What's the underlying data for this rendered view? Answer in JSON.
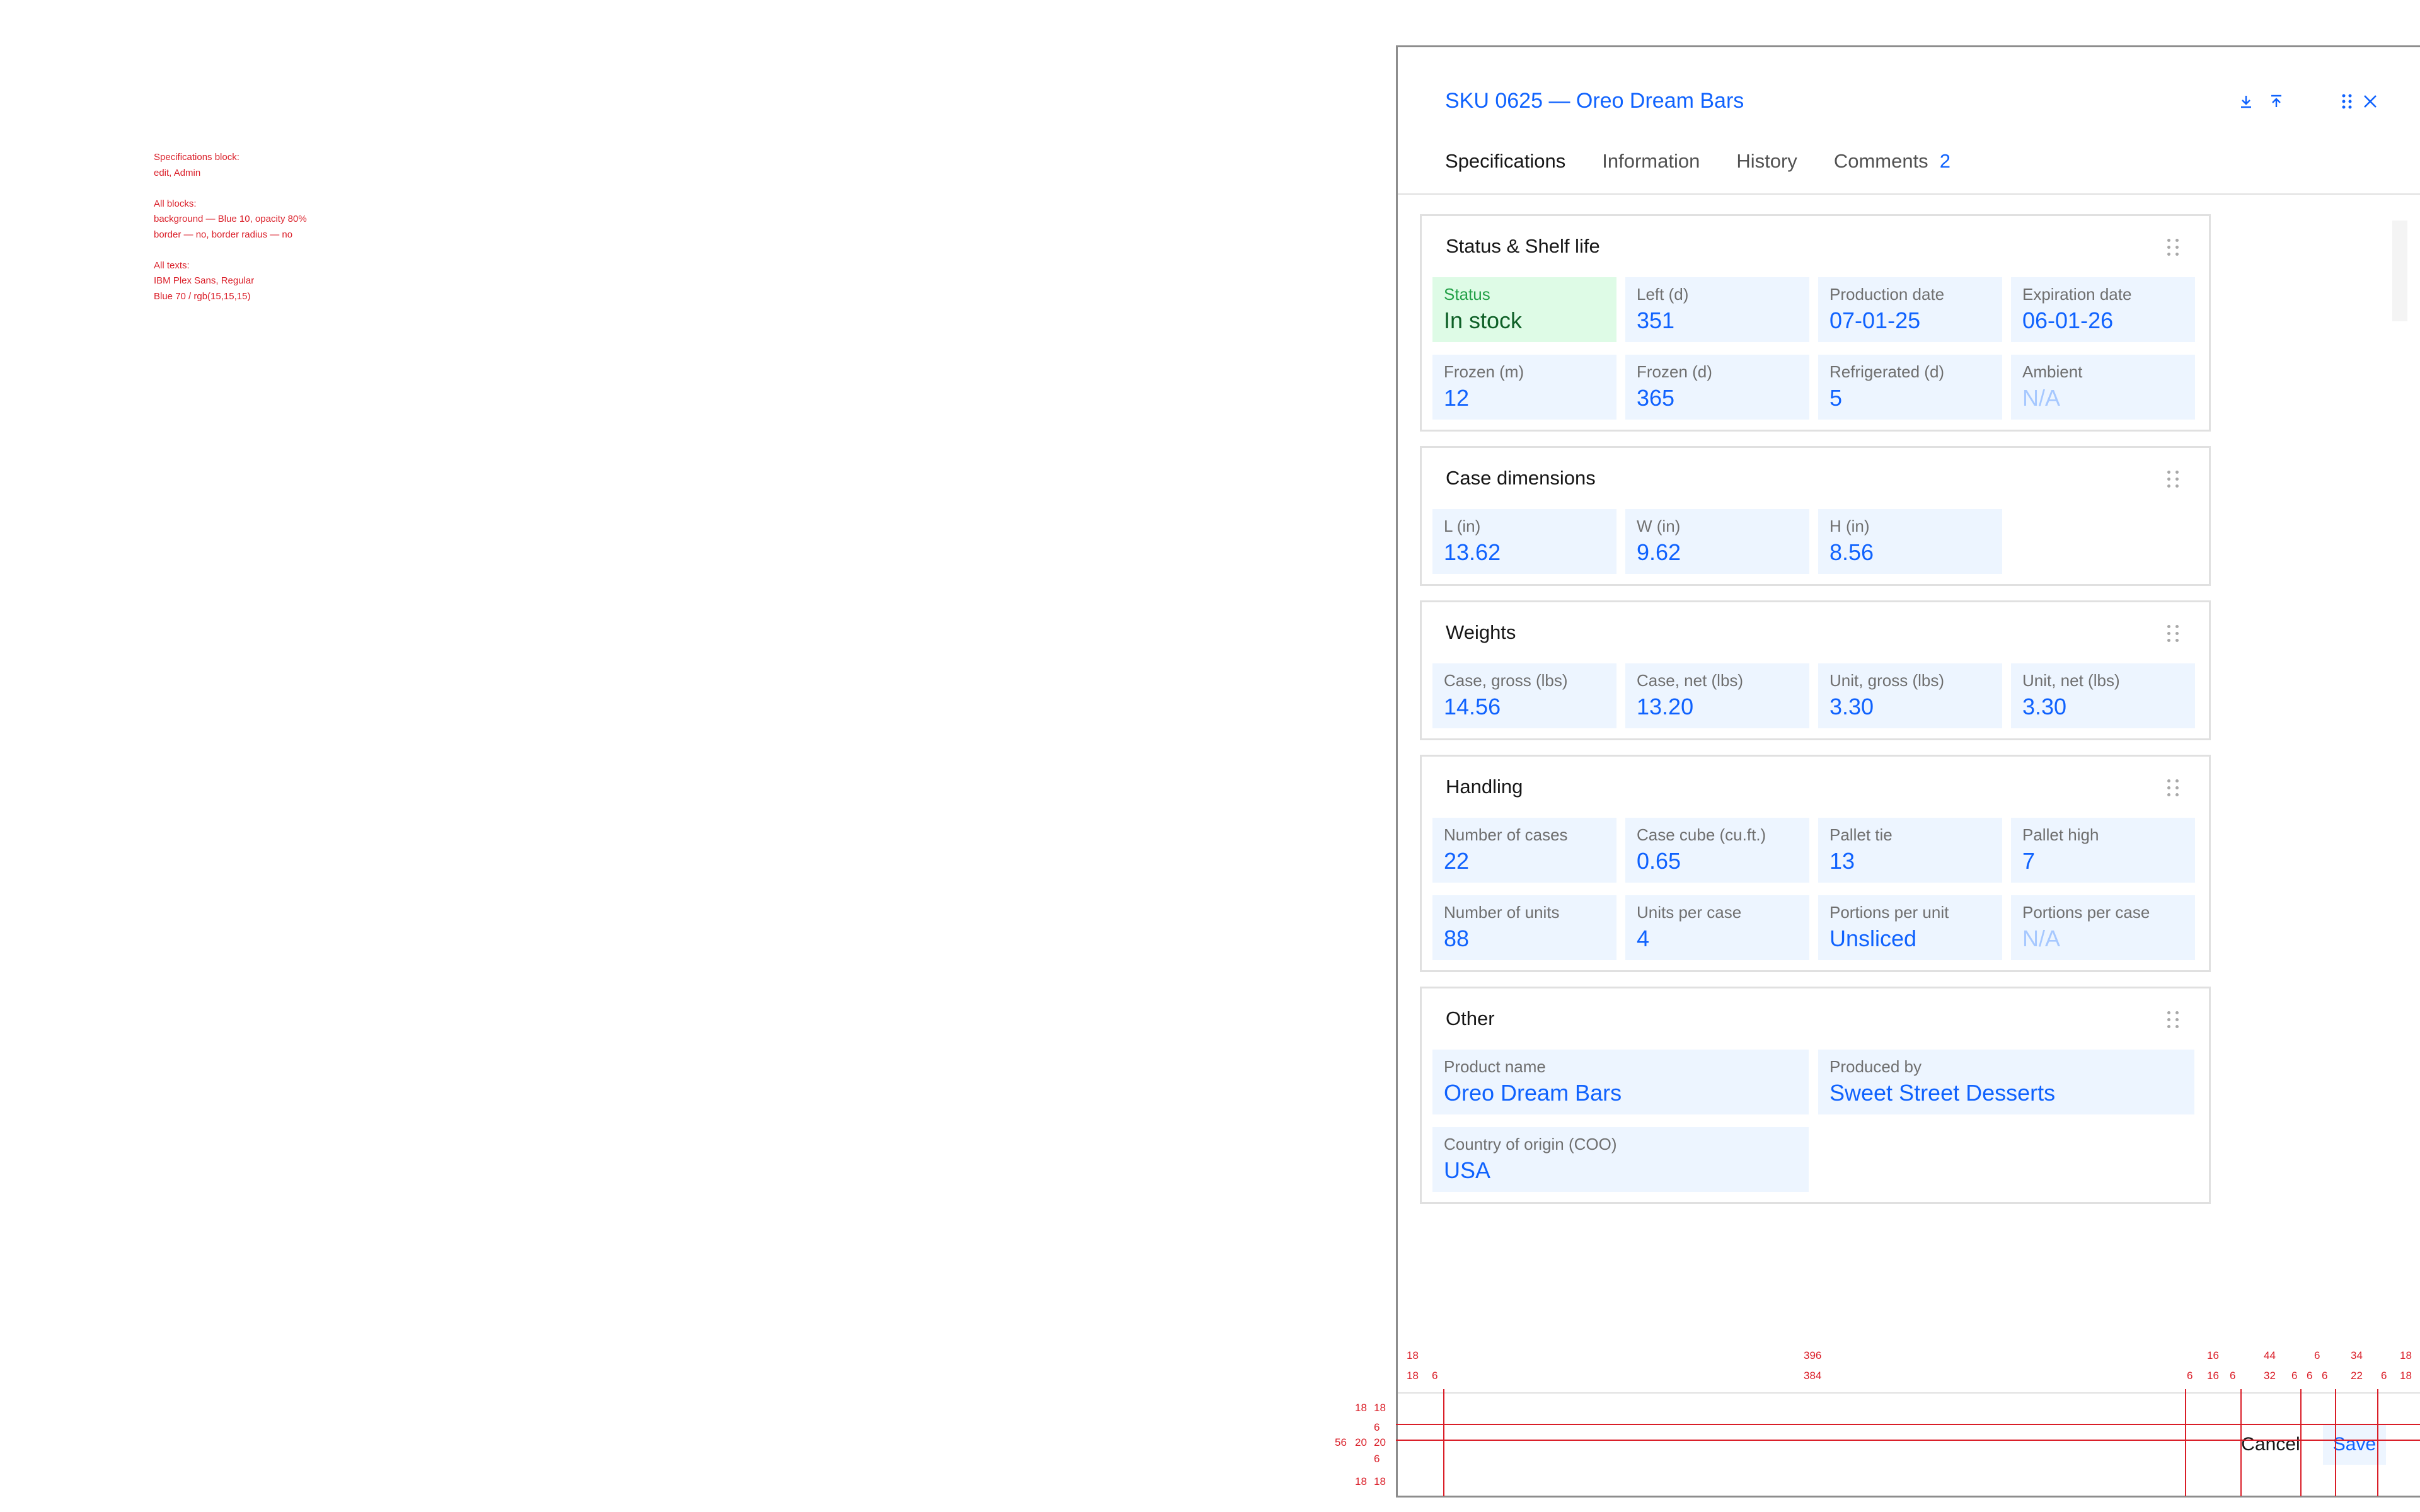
{
  "notes": [
    "Specifications block:\nedit, Admin",
    "All blocks:\nbackground — Blue 10, opacity 80%\nborder — no, border radius — no",
    "All texts:\nIBM Plex Sans, Regular\nBlue 70 / rgb(15,15,15)"
  ],
  "header": {
    "title": "SKU 0625 — Oreo Dream Bars",
    "icons": [
      "download-icon",
      "upload-icon",
      "drag-handle-icon",
      "close-icon"
    ]
  },
  "tabs": [
    {
      "label": "Specifications",
      "active": true
    },
    {
      "label": "Information"
    },
    {
      "label": "History"
    },
    {
      "label": "Comments",
      "count": "2"
    }
  ],
  "blocks": [
    {
      "title": "Status & Shelf life",
      "rows": [
        [
          {
            "label": "Status",
            "value": "In stock",
            "style": "green"
          },
          {
            "label": "Left (d)",
            "value": "351"
          },
          {
            "label": "Production date",
            "value": "07-01-25"
          },
          {
            "label": "Expiration date",
            "value": "06-01-26"
          }
        ],
        [
          {
            "label": "Frozen (m)",
            "value": "12"
          },
          {
            "label": "Frozen (d)",
            "value": "365"
          },
          {
            "label": "Refrigerated (d)",
            "value": "5"
          },
          {
            "label": "Ambient",
            "value": "N/A",
            "na": true
          }
        ]
      ]
    },
    {
      "title": "Case dimensions",
      "rows": [
        [
          {
            "label": "L (in)",
            "value": "13.62"
          },
          {
            "label": "W (in)",
            "value": "9.62"
          },
          {
            "label": "H (in)",
            "value": "8.56"
          }
        ]
      ]
    },
    {
      "title": "Weights",
      "rows": [
        [
          {
            "label": "Case, gross (lbs)",
            "value": "14.56"
          },
          {
            "label": "Case, net (lbs)",
            "value": "13.20"
          },
          {
            "label": "Unit, gross (lbs)",
            "value": "3.30"
          },
          {
            "label": "Unit, net (lbs)",
            "value": "3.30"
          }
        ]
      ]
    },
    {
      "title": "Handling",
      "rows": [
        [
          {
            "label": "Number of cases",
            "value": "22"
          },
          {
            "label": "Case cube (cu.ft.)",
            "value": "0.65"
          },
          {
            "label": "Pallet tie",
            "value": "13"
          },
          {
            "label": "Pallet high",
            "value": "7"
          }
        ],
        [
          {
            "label": "Number of units",
            "value": "88"
          },
          {
            "label": "Units per case",
            "value": "4"
          },
          {
            "label": "Portions per unit",
            "value": "Unsliced"
          },
          {
            "label": "Portions per case",
            "value": "N/A",
            "na": true
          }
        ]
      ]
    },
    {
      "title": "Other",
      "rows": [
        [
          {
            "label": "Product name",
            "value": "Oreo Dream Bars",
            "wide": true
          },
          {
            "label": "Produced by",
            "value": "Sweet Street Desserts",
            "wide": true
          }
        ],
        [
          {
            "label": "Country of origin (COO)",
            "value": "USA",
            "wide": true
          }
        ]
      ]
    }
  ],
  "footer": {
    "cancel_label": "Cancel",
    "save_label": "Save"
  },
  "redlines": {
    "top_row_1": [
      "18",
      "396",
      "16",
      "44",
      "6",
      "34",
      "18"
    ],
    "top_row_2": [
      "18",
      "6",
      "384",
      "6",
      "16",
      "6",
      "32",
      "6",
      "6",
      "6",
      "22",
      "6",
      "18"
    ],
    "left_col_1": [
      "18",
      "6",
      "20",
      "6",
      "18"
    ],
    "left_col_2": [
      "18",
      "20",
      "18"
    ],
    "left_total": "56"
  },
  "colors": {
    "accent": "#0f62fe",
    "cell_bg": "#edf5ff",
    "status_bg": "#defbe6",
    "redline": "#da1e28"
  }
}
